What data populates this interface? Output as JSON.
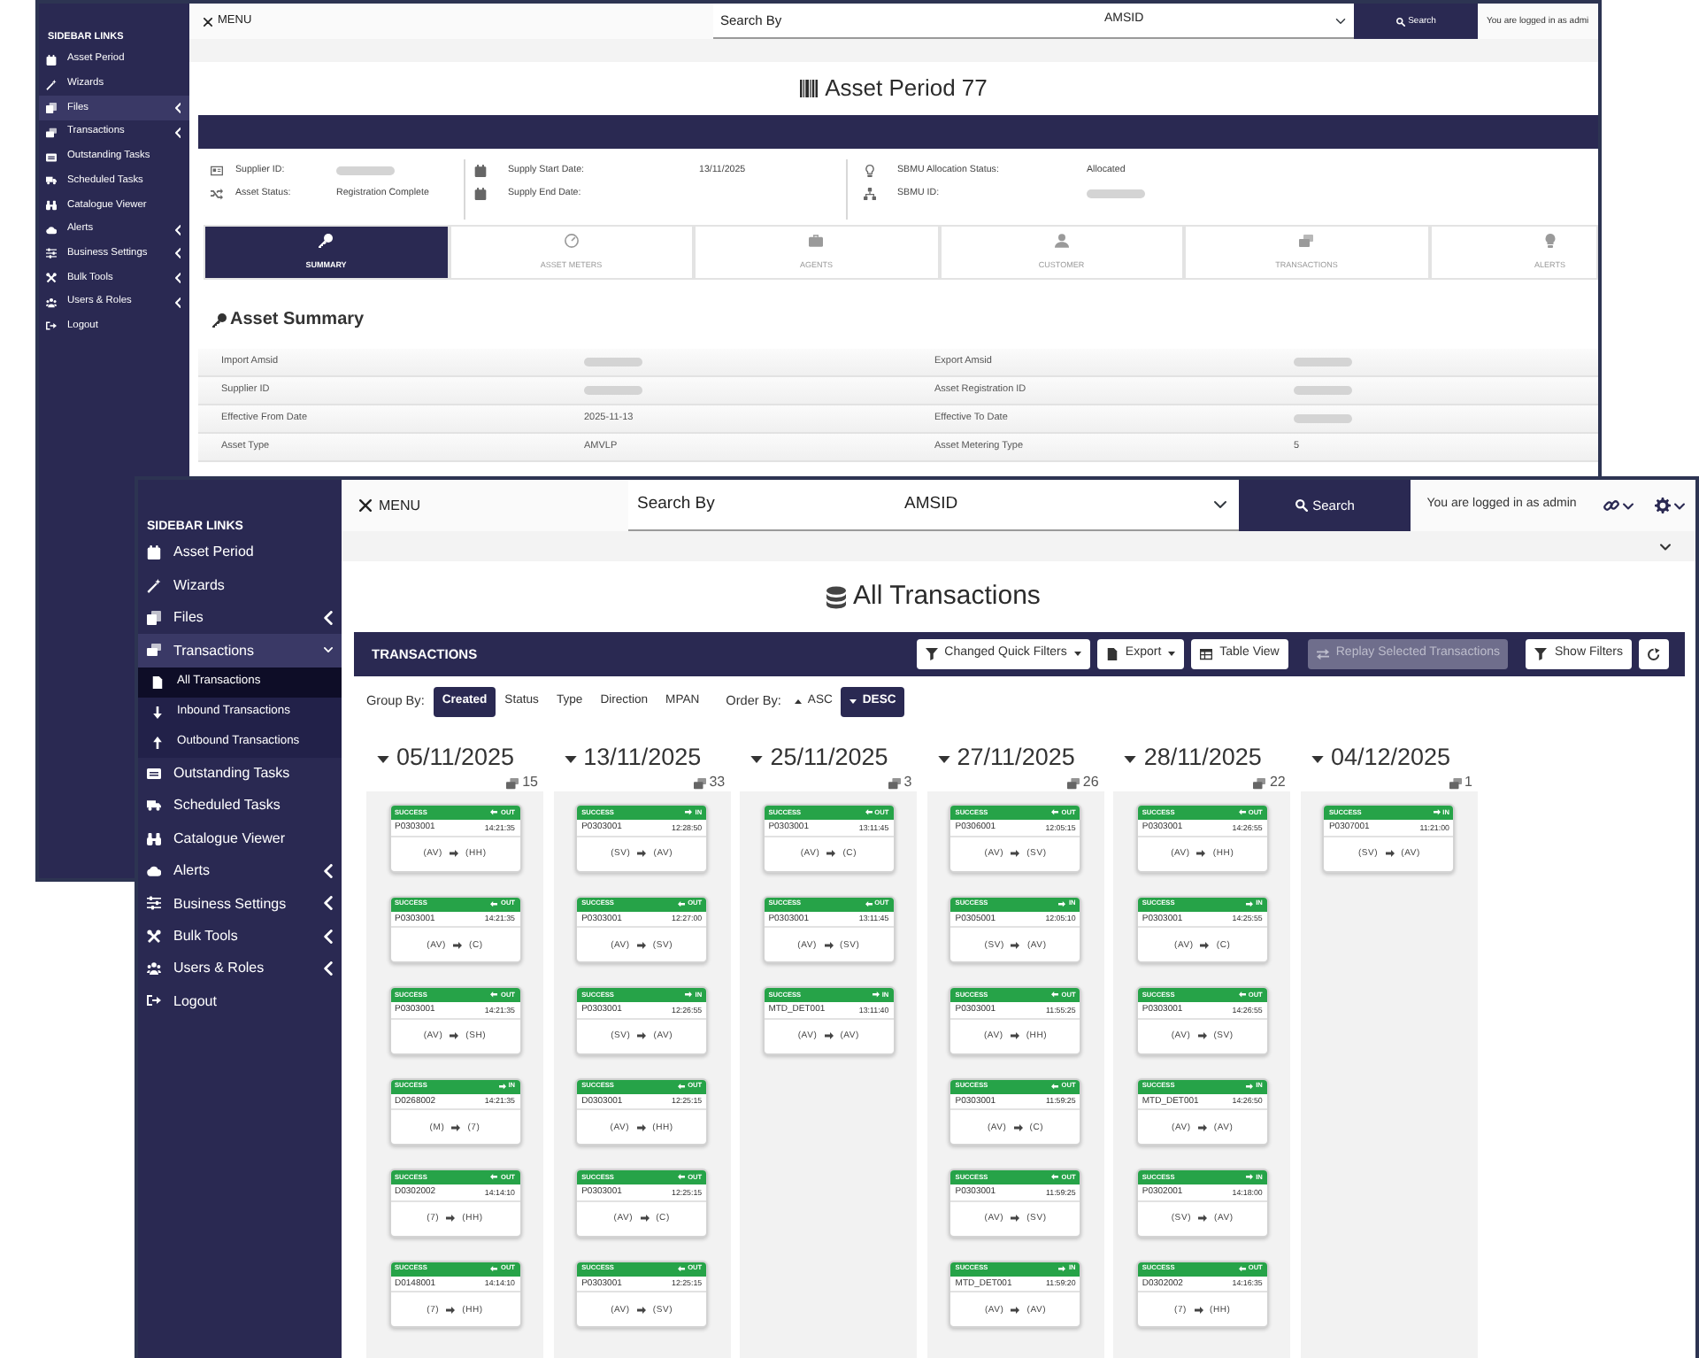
{
  "back_window": {
    "sidebar": {
      "heading": "SIDEBAR LINKS",
      "items": [
        {
          "label": "Asset Period",
          "selected": false
        },
        {
          "label": "Wizards",
          "selected": false
        },
        {
          "label": "Files",
          "selected": true,
          "expanded": false
        },
        {
          "label": "Transactions",
          "selected": false,
          "expanded": false
        },
        {
          "label": "Outstanding Tasks",
          "selected": false
        },
        {
          "label": "Scheduled Tasks",
          "selected": false
        },
        {
          "label": "Catalogue Viewer",
          "selected": false
        },
        {
          "label": "Alerts",
          "selected": false,
          "expanded": false
        },
        {
          "label": "Business Settings",
          "selected": false,
          "expanded": false
        },
        {
          "label": "Bulk Tools",
          "selected": false,
          "expanded": false
        },
        {
          "label": "Users & Roles",
          "selected": false,
          "expanded": false
        },
        {
          "label": "Logout",
          "selected": false
        }
      ]
    },
    "top_bar": {
      "menu": "MENU",
      "search_field": {
        "placeholder": "Search By"
      },
      "search_type": {
        "value": "AMSID"
      },
      "search_button": "Search",
      "login_text": "You are logged in as admi"
    },
    "title": "Asset Period 77",
    "info_columns": [
      [
        {
          "label": "Supplier ID:",
          "redacted": true
        },
        {
          "label": "Asset Status:",
          "value": "Registration Complete",
          "redacted": false
        }
      ],
      [
        {
          "label": "Supply Start Date:",
          "value": "13/11/2025",
          "redacted": false
        },
        {
          "label": "Supply End Date:",
          "redacted": false
        }
      ],
      [
        {
          "label": "SBMU Allocation Status:",
          "value": "Allocated",
          "redacted": false
        },
        {
          "label": "SBMU ID:",
          "redacted": true
        }
      ]
    ],
    "tabs": [
      {
        "label": "SUMMARY",
        "selected": true
      },
      {
        "label": "ASSET METERS",
        "selected": false
      },
      {
        "label": "AGENTS",
        "selected": false
      },
      {
        "label": "CUSTOMER",
        "selected": false
      },
      {
        "label": "TRANSACTIONS",
        "selected": false
      },
      {
        "label": "ALERTS",
        "selected": false
      }
    ],
    "summary": {
      "title": "Asset Summary",
      "rows": [
        [
          {
            "label": "Import Amsid",
            "redacted": true
          },
          {
            "label": "Export Amsid",
            "redacted": true
          }
        ],
        [
          {
            "label": "Supplier ID",
            "redacted": true
          },
          {
            "label": "Asset Registration ID",
            "redacted": true
          }
        ],
        [
          {
            "label": "Effective From Date",
            "value": "2025-11-13",
            "redacted": false
          },
          {
            "label": "Effective To Date",
            "redacted": true
          }
        ],
        [
          {
            "label": "Asset Type",
            "value": "AMVLP",
            "redacted": false
          },
          {
            "label": "Asset Metering Type",
            "value": "5",
            "redacted": false
          }
        ]
      ]
    }
  },
  "front_window": {
    "sidebar": {
      "heading": "SIDEBAR LINKS",
      "items": [
        {
          "label": "Asset Period",
          "selected": false
        },
        {
          "label": "Wizards",
          "selected": false
        },
        {
          "label": "Files",
          "selected": false,
          "expanded": false
        },
        {
          "label": "Transactions",
          "selected": true,
          "expanded": true,
          "children": [
            {
              "label": "All Transactions",
              "selected": true
            },
            {
              "label": "Inbound Transactions",
              "selected": false
            },
            {
              "label": "Outbound Transactions",
              "selected": false
            }
          ]
        },
        {
          "label": "Outstanding Tasks",
          "selected": false
        },
        {
          "label": "Scheduled Tasks",
          "selected": false
        },
        {
          "label": "Catalogue Viewer",
          "selected": false
        },
        {
          "label": "Alerts",
          "selected": false,
          "expanded": false
        },
        {
          "label": "Business Settings",
          "selected": false,
          "expanded": false
        },
        {
          "label": "Bulk Tools",
          "selected": false,
          "expanded": false
        },
        {
          "label": "Users & Roles",
          "selected": false,
          "expanded": false
        },
        {
          "label": "Logout",
          "selected": false
        }
      ]
    },
    "top_bar": {
      "menu": "MENU",
      "search_field": {
        "placeholder": "Search By"
      },
      "search_type": {
        "value": "AMSID"
      },
      "search_button": "Search",
      "login_text": "You are logged in as admin"
    },
    "title": "All Transactions",
    "panel": {
      "title": "TRANSACTIONS",
      "buttons": [
        {
          "label": "Changed Quick Filters",
          "dropdown": true,
          "disabled": false
        },
        {
          "label": "Export",
          "dropdown": true,
          "disabled": false
        },
        {
          "label": "Table View",
          "dropdown": false,
          "disabled": false
        },
        {
          "label": "Replay Selected Transactions",
          "dropdown": false,
          "disabled": true
        },
        {
          "label": "Show Filters",
          "dropdown": false,
          "disabled": false
        },
        {
          "dropdown": false,
          "disabled": false
        }
      ]
    },
    "group_by": {
      "label": "Group By:",
      "options": [
        {
          "label": "Created",
          "selected": true
        },
        {
          "label": "Status",
          "selected": false
        },
        {
          "label": "Type",
          "selected": false
        },
        {
          "label": "Direction",
          "selected": false
        },
        {
          "label": "MPAN",
          "selected": false
        }
      ]
    },
    "order_by": {
      "label": "Order By:",
      "options": [
        {
          "label": "ASC",
          "kind": "ascending",
          "selected": false
        },
        {
          "label": "DESC",
          "kind": "descending",
          "selected": true
        }
      ]
    },
    "groups": [
      {
        "date": "05/11/2025",
        "count": "15",
        "cards": [
          {
            "status": "SUCCESS",
            "kind": "outbound",
            "direction": "OUT",
            "id": "P0303001",
            "time": "14:21:35",
            "from": "(AV)",
            "to": "(HH)"
          },
          {
            "status": "SUCCESS",
            "kind": "outbound",
            "direction": "OUT",
            "id": "P0303001",
            "time": "14:21:35",
            "from": "(AV)",
            "to": "(C)"
          },
          {
            "status": "SUCCESS",
            "kind": "outbound",
            "direction": "OUT",
            "id": "P0303001",
            "time": "14:21:35",
            "from": "(AV)",
            "to": "(SH)"
          },
          {
            "status": "SUCCESS",
            "kind": "inbound",
            "direction": "IN",
            "id": "D0268002",
            "time": "14:21:35",
            "from": "(M)",
            "to": "(7)"
          },
          {
            "status": "SUCCESS",
            "kind": "outbound",
            "direction": "OUT",
            "id": "D0302002",
            "time": "14:14:10",
            "from": "(7)",
            "to": "(HH)"
          },
          {
            "status": "SUCCESS",
            "kind": "outbound",
            "direction": "OUT",
            "id": "D0148001",
            "time": "14:14:10",
            "from": "(7)",
            "to": "(HH)"
          }
        ]
      },
      {
        "date": "13/11/2025",
        "count": "33",
        "cards": [
          {
            "status": "SUCCESS",
            "kind": "inbound",
            "direction": "IN",
            "id": "P0303001",
            "time": "12:28:50",
            "from": "(SV)",
            "to": "(AV)"
          },
          {
            "status": "SUCCESS",
            "kind": "outbound",
            "direction": "OUT",
            "id": "P0303001",
            "time": "12:27:00",
            "from": "(AV)",
            "to": "(SV)"
          },
          {
            "status": "SUCCESS",
            "kind": "inbound",
            "direction": "IN",
            "id": "P0303001",
            "time": "12:26:55",
            "from": "(SV)",
            "to": "(AV)"
          },
          {
            "status": "SUCCESS",
            "kind": "outbound",
            "direction": "OUT",
            "id": "D0303001",
            "time": "12:25:15",
            "from": "(AV)",
            "to": "(HH)"
          },
          {
            "status": "SUCCESS",
            "kind": "outbound",
            "direction": "OUT",
            "id": "P0303001",
            "time": "12:25:15",
            "from": "(AV)",
            "to": "(C)"
          },
          {
            "status": "SUCCESS",
            "kind": "outbound",
            "direction": "OUT",
            "id": "P0303001",
            "time": "12:25:15",
            "from": "(AV)",
            "to": "(SV)"
          }
        ]
      },
      {
        "date": "25/11/2025",
        "count": "3",
        "cards": [
          {
            "status": "SUCCESS",
            "kind": "outbound",
            "direction": "OUT",
            "id": "P0303001",
            "time": "13:11:45",
            "from": "(AV)",
            "to": "(C)"
          },
          {
            "status": "SUCCESS",
            "kind": "outbound",
            "direction": "OUT",
            "id": "P0303001",
            "time": "13:11:45",
            "from": "(AV)",
            "to": "(SV)"
          },
          {
            "status": "SUCCESS",
            "kind": "inbound",
            "direction": "IN",
            "id": "MTD_DET001",
            "time": "13:11:40",
            "from": "(AV)",
            "to": "(AV)"
          }
        ]
      },
      {
        "date": "27/11/2025",
        "count": "26",
        "cards": [
          {
            "status": "SUCCESS",
            "kind": "outbound",
            "direction": "OUT",
            "id": "P0306001",
            "time": "12:05:15",
            "from": "(AV)",
            "to": "(SV)"
          },
          {
            "status": "SUCCESS",
            "kind": "inbound",
            "direction": "IN",
            "id": "P0305001",
            "time": "12:05:10",
            "from": "(SV)",
            "to": "(AV)"
          },
          {
            "status": "SUCCESS",
            "kind": "outbound",
            "direction": "OUT",
            "id": "P0303001",
            "time": "11:55:25",
            "from": "(AV)",
            "to": "(HH)"
          },
          {
            "status": "SUCCESS",
            "kind": "outbound",
            "direction": "OUT",
            "id": "P0303001",
            "time": "11:59:25",
            "from": "(AV)",
            "to": "(C)"
          },
          {
            "status": "SUCCESS",
            "kind": "outbound",
            "direction": "OUT",
            "id": "P0303001",
            "time": "11:59:25",
            "from": "(AV)",
            "to": "(SV)"
          },
          {
            "status": "SUCCESS",
            "kind": "inbound",
            "direction": "IN",
            "id": "MTD_DET001",
            "time": "11:59:20",
            "from": "(AV)",
            "to": "(AV)"
          }
        ]
      },
      {
        "date": "28/11/2025",
        "count": "22",
        "cards": [
          {
            "status": "SUCCESS",
            "kind": "outbound",
            "direction": "OUT",
            "id": "P0303001",
            "time": "14:26:55",
            "from": "(AV)",
            "to": "(HH)"
          },
          {
            "status": "SUCCESS",
            "kind": "inbound",
            "direction": "IN",
            "id": "P0303001",
            "time": "14:25:55",
            "from": "(AV)",
            "to": "(C)"
          },
          {
            "status": "SUCCESS",
            "kind": "outbound",
            "direction": "OUT",
            "id": "P0303001",
            "time": "14:26:55",
            "from": "(AV)",
            "to": "(SV)"
          },
          {
            "status": "SUCCESS",
            "kind": "inbound",
            "direction": "IN",
            "id": "MTD_DET001",
            "time": "14:26:50",
            "from": "(AV)",
            "to": "(AV)"
          },
          {
            "status": "SUCCESS",
            "kind": "inbound",
            "direction": "IN",
            "id": "P0302001",
            "time": "14:18:00",
            "from": "(SV)",
            "to": "(AV)"
          },
          {
            "status": "SUCCESS",
            "kind": "outbound",
            "direction": "OUT",
            "id": "D0302002",
            "time": "14:16:35",
            "from": "(7)",
            "to": "(HH)"
          }
        ]
      },
      {
        "date": "04/12/2025",
        "count": "1",
        "cards": [
          {
            "status": "SUCCESS",
            "kind": "inbound",
            "direction": "IN",
            "id": "P0307001",
            "time": "11:21:00",
            "from": "(SV)",
            "to": "(AV)"
          }
        ]
      }
    ]
  }
}
